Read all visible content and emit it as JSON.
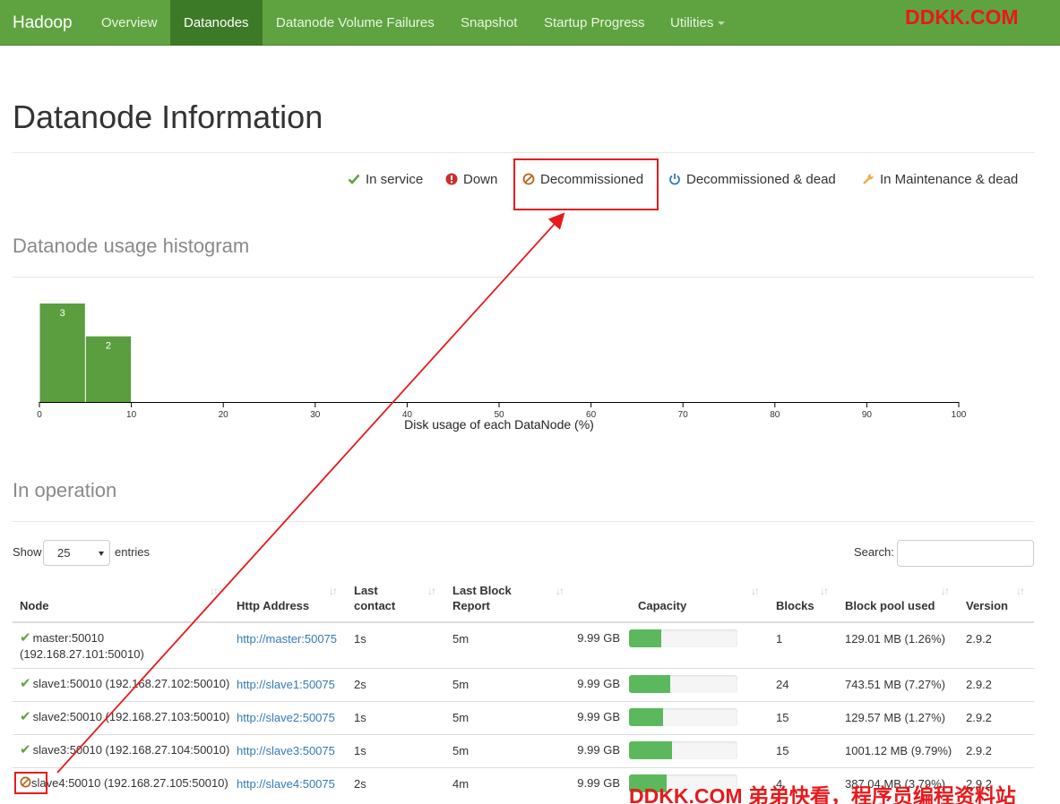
{
  "navbar": {
    "brand": "Hadoop",
    "items": [
      {
        "label": "Overview",
        "active": false
      },
      {
        "label": "Datanodes",
        "active": true
      },
      {
        "label": "Datanode Volume Failures",
        "active": false
      },
      {
        "label": "Snapshot",
        "active": false
      },
      {
        "label": "Startup Progress",
        "active": false
      },
      {
        "label": "Utilities",
        "active": false
      }
    ],
    "watermark": "DDKK.COM"
  },
  "page_title": "Datanode Information",
  "legend": [
    {
      "label": "In service",
      "icon": "check-icon",
      "color": "#5fa341"
    },
    {
      "label": "Down",
      "icon": "exclamation-icon",
      "color": "#c9302c"
    },
    {
      "label": "Decommissioned",
      "icon": "ban-icon",
      "color": "#b5651d"
    },
    {
      "label": "Decommissioned & dead",
      "icon": "power-icon",
      "color": "#337ab7"
    },
    {
      "label": "In Maintenance & dead",
      "icon": "wrench-icon",
      "color": "#f0ad4e"
    }
  ],
  "histogram_title": "Datanode usage histogram",
  "chart_data": {
    "type": "bar",
    "title": "",
    "xlabel": "Disk usage of each DataNode (%)",
    "ylabel": "",
    "xlim": [
      0,
      100
    ],
    "xticks": [
      0,
      10,
      20,
      30,
      40,
      50,
      60,
      70,
      80,
      90,
      100
    ],
    "bins": [
      {
        "from": 0,
        "to": 5,
        "count": 3
      },
      {
        "from": 5,
        "to": 10,
        "count": 2
      }
    ],
    "color": "#5a9e3f"
  },
  "operation_title": "In operation",
  "table_controls": {
    "show_label": "Show",
    "entries_value": "25",
    "entries_label": "entries",
    "search_label": "Search:"
  },
  "table": {
    "headers": [
      "Node",
      "Http Address",
      "Last contact",
      "Last Block Report",
      "Capacity",
      "Blocks",
      "Block pool used",
      "Version"
    ],
    "header_lines": {
      "last_contact": [
        "Last",
        "contact"
      ],
      "last_block_report": [
        "Last Block",
        "Report"
      ]
    },
    "rows": [
      {
        "status": "in-service",
        "node": "master:50010",
        "node_ip": "(192.168.27.101:50010)",
        "http": "http://master:50075",
        "last_contact": "1s",
        "last_block_report": "5m",
        "capacity": "9.99 GB",
        "used_fraction": 0.3,
        "blocks": "1",
        "pool_used": "129.01 MB (1.26%)",
        "version": "2.9.2"
      },
      {
        "status": "in-service",
        "node": "slave1:50010 (192.168.27.102:50010)",
        "node_ip": "",
        "http": "http://slave1:50075",
        "last_contact": "2s",
        "last_block_report": "5m",
        "capacity": "9.99 GB",
        "used_fraction": 0.38,
        "blocks": "24",
        "pool_used": "743.51 MB (7.27%)",
        "version": "2.9.2"
      },
      {
        "status": "in-service",
        "node": "slave2:50010 (192.168.27.103:50010)",
        "node_ip": "",
        "http": "http://slave2:50075",
        "last_contact": "1s",
        "last_block_report": "5m",
        "capacity": "9.99 GB",
        "used_fraction": 0.31,
        "blocks": "15",
        "pool_used": "129.57 MB (1.27%)",
        "version": "2.9.2"
      },
      {
        "status": "in-service",
        "node": "slave3:50010 (192.168.27.104:50010)",
        "node_ip": "",
        "http": "http://slave3:50075",
        "last_contact": "1s",
        "last_block_report": "5m",
        "capacity": "9.99 GB",
        "used_fraction": 0.4,
        "blocks": "15",
        "pool_used": "1001.12 MB (9.79%)",
        "version": "2.9.2"
      },
      {
        "status": "decommissioned",
        "node": "slave4:50010 (192.168.27.105:50010)",
        "node_ip": "",
        "http": "http://slave4:50075",
        "last_contact": "2s",
        "last_block_report": "4m",
        "capacity": "9.99 GB",
        "used_fraction": 0.35,
        "blocks": "4",
        "pool_used": "387.04 MB (3.79%)",
        "version": "2.9.2"
      }
    ]
  },
  "watermark_bottom": "DDKK.COM 弟弟快看，程序员编程资料站"
}
